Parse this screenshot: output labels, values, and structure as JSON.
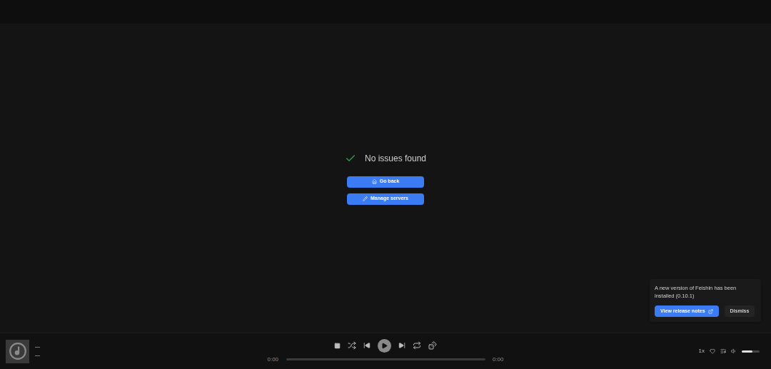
{
  "status": {
    "message": "No issues found"
  },
  "actions": [
    {
      "label": "Go back",
      "kind": "home"
    },
    {
      "label": "Manage servers",
      "kind": "edit"
    }
  ],
  "toast": {
    "message": "A new version of Feishin has been installed (0.10.1)",
    "primary": "View release notes",
    "secondary": "Dismiss"
  },
  "player": {
    "title": "—",
    "artist": "—",
    "elapsed": "0:00",
    "duration": "0:00",
    "speed": "1x",
    "volume": {
      "level": 0.6
    }
  }
}
